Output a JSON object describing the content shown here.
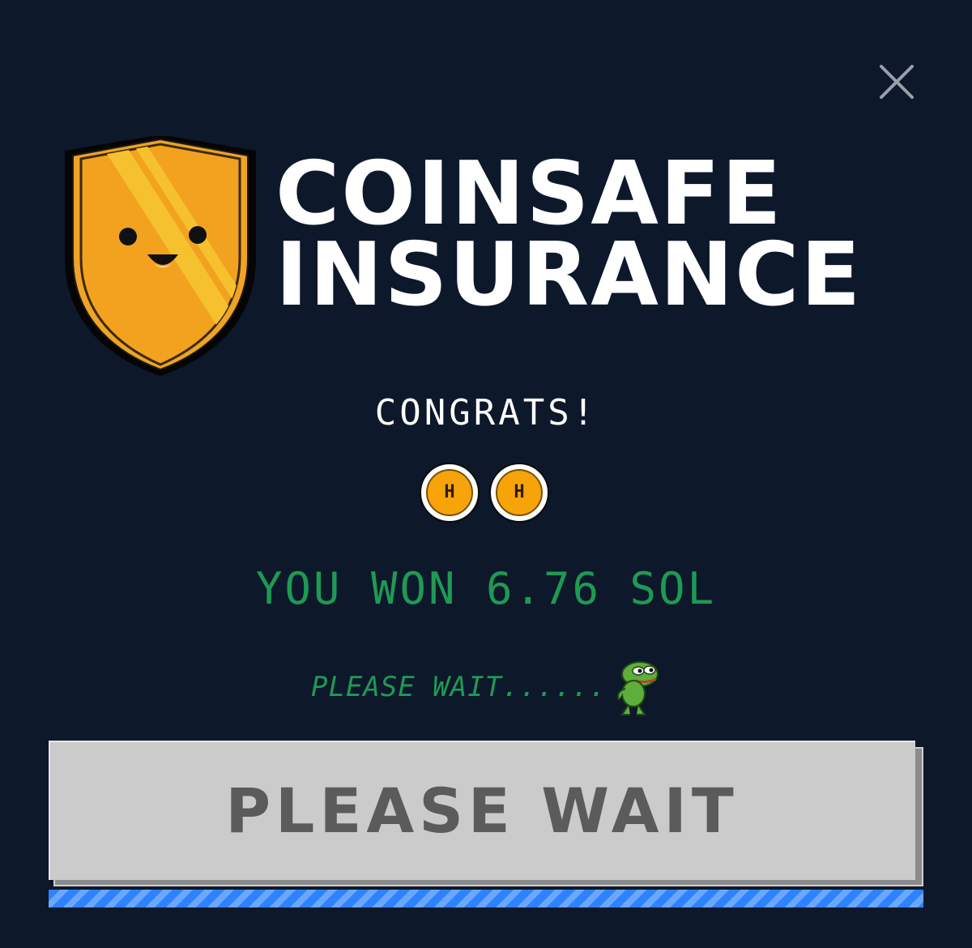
{
  "logo": {
    "line1": "COINSAFE",
    "line2": "INSURANCE",
    "shield_icon": "smiling-shield-icon"
  },
  "congrats_text": "CONGRATS!",
  "coins": [
    {
      "label": "H",
      "icon": "coin-icon"
    },
    {
      "label": "H",
      "icon": "coin-icon"
    }
  ],
  "result_text": "YOU WON 6.76 SOL",
  "status_text": "PLEASE WAIT......",
  "status_icon": "frog-mascot-icon",
  "button": {
    "label": "PLEASE WAIT"
  },
  "progress": {
    "value": 1.0
  },
  "colors": {
    "background": "#0e182b",
    "accent_green": "#1e9a54",
    "shield_gold": "#f0a325",
    "button_gray": "#cbcbcb",
    "progress_blue": "#2f82ff"
  }
}
